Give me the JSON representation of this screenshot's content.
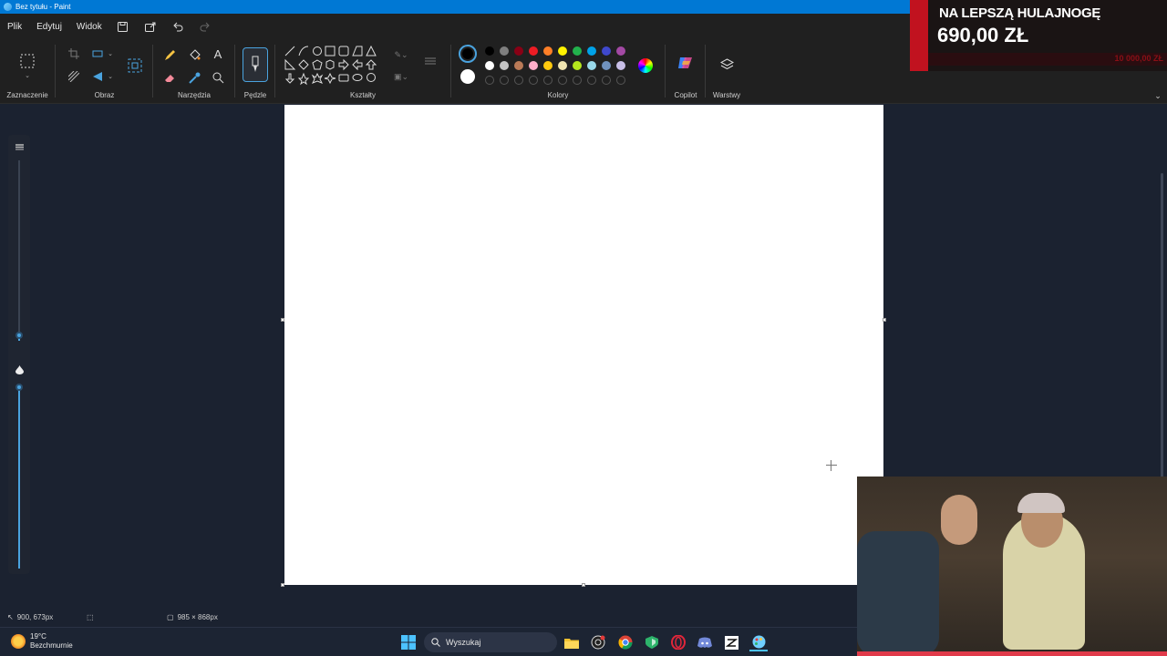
{
  "window": {
    "title": "Bez tytułu - Paint"
  },
  "menu": {
    "file": "Plik",
    "edit": "Edytuj",
    "view": "Widok"
  },
  "ribbon": {
    "groups": {
      "selection": "Zaznaczenie",
      "image": "Obraz",
      "tools": "Narzędzia",
      "brushes": "Pędzle",
      "shapes": "Kształty",
      "colors": "Kolory",
      "copilot": "Copilot",
      "layers": "Warstwy"
    },
    "palette_row1": [
      "#000000",
      "#7f7f7f",
      "#880015",
      "#ed1c24",
      "#ff7f27",
      "#fff200",
      "#22b14c",
      "#00a2e8",
      "#3f48cc",
      "#a349a4"
    ],
    "palette_row2": [
      "#ffffff",
      "#c3c3c3",
      "#b97a57",
      "#ffaec9",
      "#ffc90e",
      "#efe4b0",
      "#b5e61d",
      "#99d9ea",
      "#7092be",
      "#c8bfe7"
    ],
    "primary_color": "#000000",
    "secondary_color": "#ffffff"
  },
  "status": {
    "cursor_position": "900, 673px",
    "canvas_size": "985 × 868px"
  },
  "taskbar": {
    "weather_temp": "19°C",
    "weather_desc": "Bezchmurnie",
    "search_placeholder": "Wyszukaj"
  },
  "overlay": {
    "goal_title": "NA LEPSZĄ HULAJNOGĘ",
    "goal_current": "690,00 ZŁ",
    "goal_target": "10 000,00 ZŁ"
  }
}
